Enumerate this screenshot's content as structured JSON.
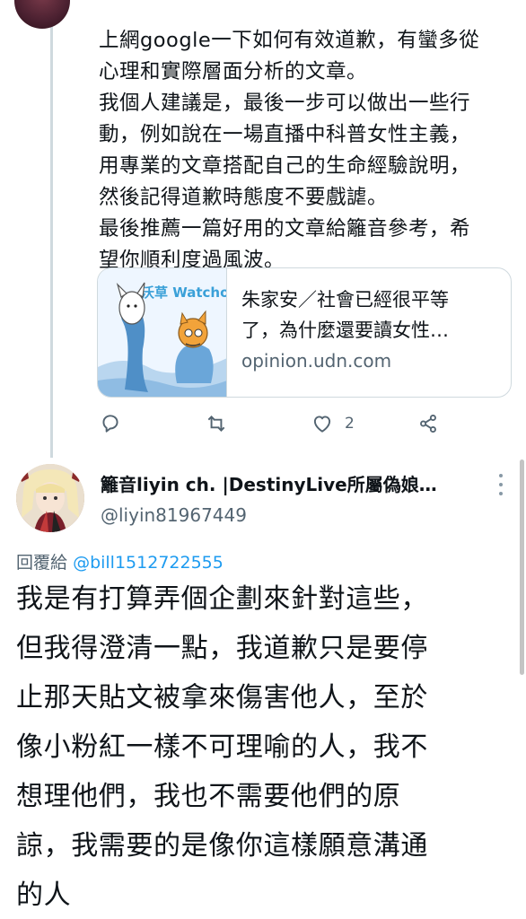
{
  "previous_tweet": {
    "lines": [
      "上網google一下如何有效道歉，有蠻多從",
      "心理和實際層面分析的文章。",
      "我個人建議是，最後一步可以做出一些行",
      "動，例如說在一場直播中科普女性主義，",
      "用專業的文章搭配自己的生命經驗說明，",
      "然後記得道歉時態度不要戲謔。",
      "最後推薦一篇好用的文章給籬音參考，希",
      "望你順利度過風波。"
    ],
    "link_card": {
      "thumb_label": "沃草 Watchout",
      "title_line1": "朱家安／社會已經很平等",
      "title_line2": "了，為什麼還要讀女性…",
      "domain": "opinion.udn.com"
    },
    "actions": {
      "reply_icon": "reply-icon",
      "retweet_icon": "retweet-icon",
      "like_icon": "heart-icon",
      "like_count": "2",
      "share_icon": "share-icon"
    }
  },
  "reply_tweet": {
    "author_name": "籬音liyin ch. |DestinyLive所屬偽娘…",
    "author_handle": "@liyin81967449",
    "reply_prefix": "回覆給",
    "reply_mention": "@bill1512722555",
    "lines": [
      "我是有打算弄個企劃來針對這些，",
      "但我得澄清一點，我道歉只是要停",
      "止那天貼文被拿來傷害他人，至於",
      "像小粉紅一樣不可理喻的人，我不",
      "想理他們，我也不需要他們的原",
      "諒，我需要的是像你這樣願意溝通",
      "的人"
    ]
  },
  "colors": {
    "text": "#0f1419",
    "secondary": "#536471",
    "accent": "#1d9bf0",
    "border": "#cfd9de"
  }
}
